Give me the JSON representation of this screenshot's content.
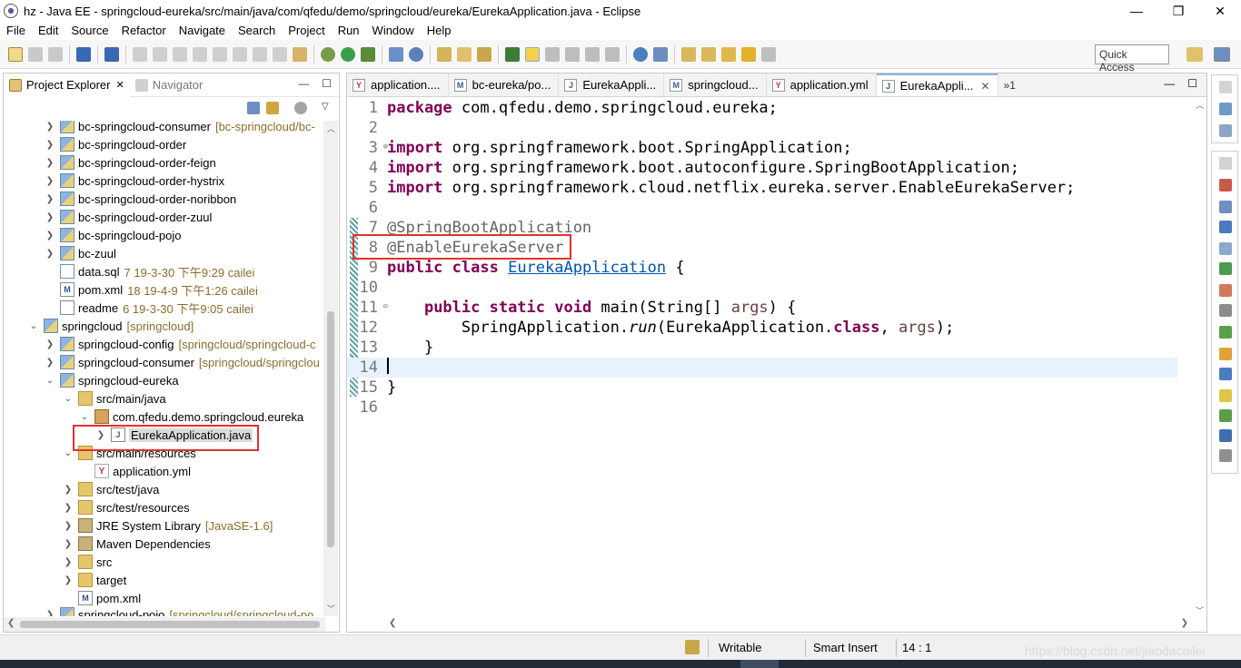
{
  "window": {
    "title": "hz - Java EE - springcloud-eureka/src/main/java/com/qfedu/demo/springcloud/eureka/EurekaApplication.java - Eclipse",
    "minimize_glyph": "—",
    "maximize_glyph": "❐",
    "close_glyph": "✕"
  },
  "menu": [
    "File",
    "Edit",
    "Source",
    "Refactor",
    "Navigate",
    "Search",
    "Project",
    "Run",
    "Window",
    "Help"
  ],
  "toolbar": {
    "quick_access": "Quick Access"
  },
  "explorer": {
    "tabs": [
      {
        "label": "Project Explorer",
        "close": "✕"
      },
      {
        "label": "Navigator"
      }
    ],
    "min_glyph": "—",
    "max_glyph": "☐",
    "tree": [
      {
        "label": "bc-springcloud-consumer",
        "dec": "[bc-springcloud/bc-"
      },
      {
        "label": "bc-springcloud-order",
        "dec": ""
      },
      {
        "label": "bc-springcloud-order-feign",
        "dec": ""
      },
      {
        "label": "bc-springcloud-order-hystrix",
        "dec": ""
      },
      {
        "label": "bc-springcloud-order-noribbon",
        "dec": ""
      },
      {
        "label": "bc-springcloud-order-zuul",
        "dec": ""
      },
      {
        "label": "bc-springcloud-pojo",
        "dec": ""
      },
      {
        "label": "bc-zuul",
        "dec": ""
      },
      {
        "label": "data.sql",
        "dec": "7  19-3-30 下午9:29  cailei"
      },
      {
        "label": "pom.xml",
        "dec": "18  19-4-9 下午1:26  cailei"
      },
      {
        "label": "readme",
        "dec": "6  19-3-30 下午9:05  cailei"
      },
      {
        "label": "springcloud",
        "dec": "[springcloud]"
      },
      {
        "label": "springcloud-config",
        "dec": "[springcloud/springcloud-c"
      },
      {
        "label": "springcloud-consumer",
        "dec": "[springcloud/springclou"
      },
      {
        "label": "springcloud-eureka",
        "dec": ""
      },
      {
        "label": "src/main/java",
        "dec": ""
      },
      {
        "label": "com.qfedu.demo.springcloud.eureka",
        "dec": ""
      },
      {
        "label": "EurekaApplication.java",
        "dec": ""
      },
      {
        "label": "src/main/resources",
        "dec": ""
      },
      {
        "label": "application.yml",
        "dec": ""
      },
      {
        "label": "src/test/java",
        "dec": ""
      },
      {
        "label": "src/test/resources",
        "dec": ""
      },
      {
        "label": "JRE System Library",
        "dec": "[JavaSE-1.6]"
      },
      {
        "label": "Maven Dependencies",
        "dec": ""
      },
      {
        "label": "src",
        "dec": ""
      },
      {
        "label": "target",
        "dec": ""
      },
      {
        "label": "pom.xml",
        "dec": ""
      },
      {
        "label": "springcloud-pojo",
        "dec": "[springcloud/springcloud-po"
      }
    ]
  },
  "editor": {
    "tabs": [
      {
        "label": "application....",
        "icon": "Y"
      },
      {
        "label": "bc-eureka/po...",
        "icon": "M"
      },
      {
        "label": "EurekaAppli...",
        "icon": "J"
      },
      {
        "label": "springcloud...",
        "icon": "M"
      },
      {
        "label": "application.yml",
        "icon": "Y"
      },
      {
        "label": "EurekaAppli...",
        "icon": "J",
        "close": "✕"
      }
    ],
    "overflow_label": "»1",
    "line_numbers": [
      "1",
      "2",
      "3",
      "4",
      "5",
      "6",
      "7",
      "8",
      "9",
      "10",
      "11",
      "12",
      "13",
      "14",
      "15",
      "16"
    ],
    "code": {
      "l1_kw": "package",
      "l1_rest": " com.qfedu.demo.springcloud.eureka;",
      "l3_kw": "import",
      "l3_rest": " org.springframework.boot.SpringApplication;",
      "l4_kw": "import",
      "l4_rest": " org.springframework.boot.autoconfigure.SpringBootApplication;",
      "l5_kw": "import",
      "l5_rest": " org.springframework.cloud.netflix.eureka.server.EnableEurekaServer;",
      "l7_ann": "@SpringBootApplication",
      "l8_ann": "@EnableEurekaServer",
      "l9_kw": "public class",
      "l9_cls": "EurekaApplication",
      "l9_rest": " {",
      "l11_indent": "    ",
      "l11_kw": "public static void",
      "l11_rest": " main(String[] ",
      "l11_param": "args",
      "l11_end": ") {",
      "l12_indent": "        SpringApplication.",
      "l12_method": "run",
      "l12_mid": "(EurekaApplication.",
      "l12_kw": "class",
      "l12_sep": ", ",
      "l12_param": "args",
      "l12_end": ");",
      "l13": "    }",
      "l15": "}"
    }
  },
  "status": {
    "writable": "Writable",
    "insert_mode": "Smart Insert",
    "position": "14 : 1",
    "watermark": "https://blog.csdn.net/jiaodacailei"
  },
  "colors": {
    "highlight_box": "#e0322f",
    "keyword": "#7f0055",
    "annotation": "#646464",
    "current_line": "#e8f2fe"
  }
}
